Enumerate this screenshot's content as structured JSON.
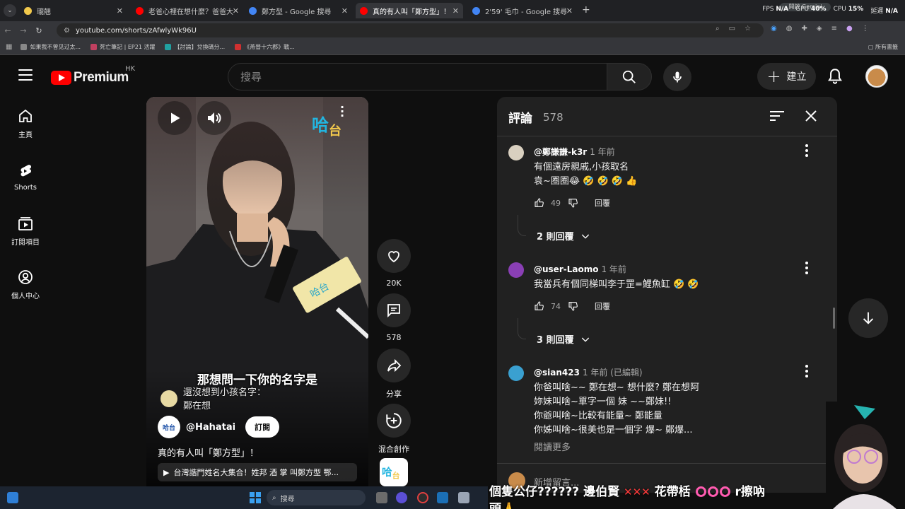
{
  "browser": {
    "tabs": [
      {
        "title": "瓏翹",
        "favicon_color": "#f2c94c",
        "active": false
      },
      {
        "title": "老爸心裡在想什麼？爸爸大調查",
        "favicon_color": "#ff0000",
        "active": false
      },
      {
        "title": "鄭方型 - Google 搜尋",
        "favicon_color": "#4285f4",
        "active": false
      },
      {
        "title": "真的有人叫「鄭方型」！ - YouTube",
        "favicon_color": "#ff0000",
        "active": true
      },
      {
        "title": "2'59' 毛巾 - Google 搜尋",
        "favicon_color": "#4285f4",
        "active": false
      }
    ],
    "close_glyph": "✕",
    "new_tab_glyph": "+",
    "gemini_label": "開啟 Gemini",
    "stats": {
      "fps_label": "FPS",
      "fps": "N/A",
      "gpu_label": "GPU",
      "gpu": "40%",
      "cpu_label": "CPU",
      "cpu": "15%",
      "latency_label": "延遲",
      "latency": "N/A"
    },
    "url": "youtube.com/shorts/zAfwlyWk96U",
    "bookmarks": [
      {
        "label": "如果我不曾见过太...",
        "color": "#888"
      },
      {
        "label": "死亡筆記 | EP21 活躍",
        "color": "#c04060"
      },
      {
        "label": "【討論】兌換碼分...",
        "color": "#20a0a0"
      },
      {
        "label": "《燕晉十六郡》戰...",
        "color": "#d03030"
      }
    ],
    "all_bookmarks": "所有書籤"
  },
  "yt": {
    "brand": "Premium",
    "region": "HK",
    "search_placeholder": "搜尋",
    "create_label": "建立",
    "nav": [
      {
        "label": "主頁",
        "icon": "home-icon"
      },
      {
        "label": "Shorts",
        "icon": "shorts-icon"
      },
      {
        "label": "訂閱項目",
        "icon": "subscriptions-icon"
      },
      {
        "label": "個人中心",
        "icon": "account-icon"
      }
    ]
  },
  "short": {
    "subtitle_main": "那想問一下你的名字是",
    "subtitle_small_line1": "還沒想到小孩名字：",
    "subtitle_small_line2": "鄭在想",
    "channel": "@Hahatai",
    "subscribe": "訂閱",
    "title": "真的有人叫「鄭方型」！",
    "related": "台灣諧門姓名大集合！姓邦 酒 掌 叫鄭方型 鄂...",
    "actions": {
      "likes": "20K",
      "comments": "578",
      "share": "分享",
      "remix": "混合創作"
    }
  },
  "comments": {
    "title": "評論",
    "count": "578",
    "items": [
      {
        "author": "@鄭謙謙-k3r",
        "time": "1 年前",
        "lines": [
          "有個遠房親戚,小孩取名",
          "袁~圈圈😂 🤣 🤣 🤣 👍"
        ],
        "likes": "49",
        "reply": "回覆",
        "replies": "2 則回覆",
        "avatar_color": "#d9d0c0"
      },
      {
        "author": "@user-Laomo",
        "time": "1 年前",
        "lines": [
          "我當兵有個同梯叫李于罡=鯉魚缸 🤣 🤣"
        ],
        "likes": "74",
        "reply": "回覆",
        "replies": "3 則回覆",
        "avatar_color": "#8a3fb5"
      },
      {
        "author": "@sian423",
        "time": "1 年前 (已編輯)",
        "lines": [
          "你爸叫啥~~ 鄭在想~  想什麼? 鄭在想阿",
          "妳妹叫啥~單字一個 妹 ~~鄭妹!!",
          "你爺叫啥~比較有能量~ 鄭能量",
          "你姊叫啥~很美也是一個字 爆~ 鄭爆..."
        ],
        "readmore": "閱讀更多",
        "avatar_color": "#3aa0d0"
      }
    ],
    "add_placeholder": "新增留言..."
  },
  "overlay": {
    "danmaku_text1": "個隻公仔?????? 邊伯賢",
    "danmaku_x": "✕✕✕",
    "danmaku_text2": "花帶栝",
    "danmaku_text3": "r擦吶",
    "danmaku_text4": "頭🙏"
  },
  "taskbar": {
    "search_label": "搜尋"
  }
}
